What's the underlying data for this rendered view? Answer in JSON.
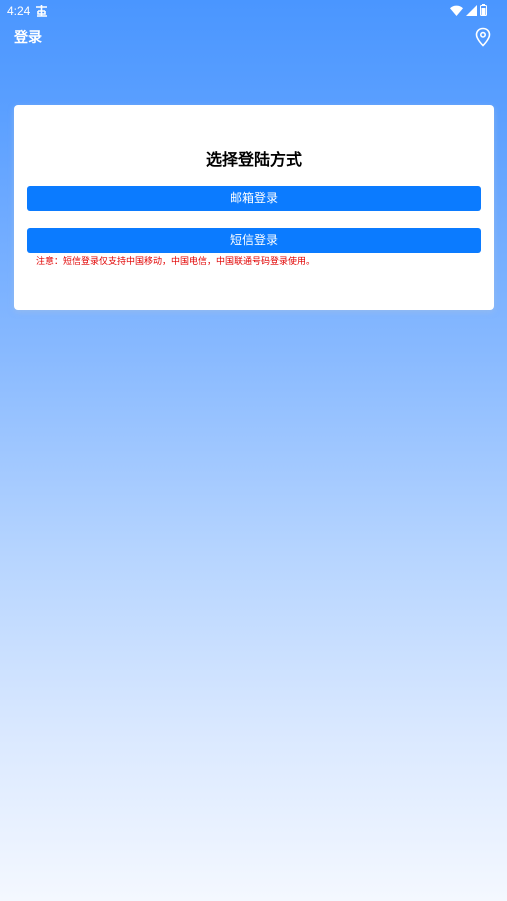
{
  "status_bar": {
    "time": "4:24"
  },
  "app_bar": {
    "title": "登录"
  },
  "card": {
    "title": "选择登陆方式",
    "email_login_label": "邮箱登录",
    "sms_login_label": "短信登录",
    "note": "注意：短信登录仅支持中国移动，中国电信，中国联通号码登录使用。"
  },
  "colors": {
    "button": "#0b7bff",
    "note": "#e10000",
    "background_top": "#4a96ff",
    "background_bottom": "#f4f8ff"
  },
  "icons": {
    "status_notification": "notification-icon",
    "status_wifi": "wifi-icon",
    "status_signal": "signal-icon",
    "status_battery": "battery-icon",
    "app_bar_action": "location-pin-icon"
  }
}
